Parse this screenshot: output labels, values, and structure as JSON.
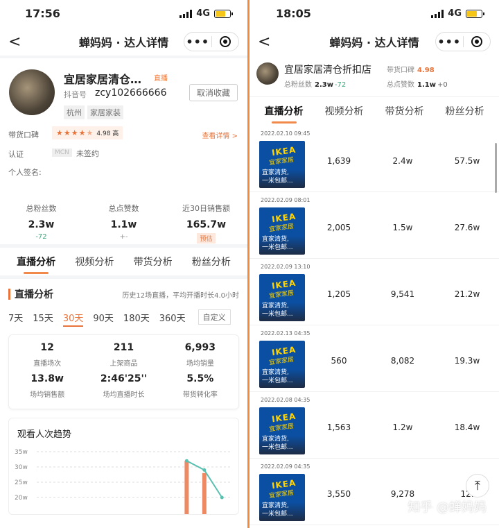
{
  "left": {
    "status": {
      "time": "17:56",
      "network": "4G"
    },
    "nav": {
      "title": "蝉妈妈 · 达人详情",
      "back": "<",
      "menu": "•••"
    },
    "profile": {
      "name": "宜居家居清仓…",
      "crown": "直播",
      "douyin_label": "抖音号",
      "douyin_id": "zcy102666666",
      "unfavorite": "取消收藏",
      "tags": [
        "杭州",
        "家居家装"
      ],
      "reputation_label": "带货口碑",
      "reputation_score": "4.98 高",
      "stars": 4.5,
      "detail_link": "查看详情 >",
      "cert_label": "认证",
      "mcn": "MCN",
      "cert_value": "未签约",
      "signature_label": "个人签名:"
    },
    "stats": [
      {
        "label": "总粉丝数",
        "value": "2.3w",
        "sub": "-72"
      },
      {
        "label": "总点赞数",
        "value": "1.1w",
        "sub": "+-"
      },
      {
        "label": "近30日销售额",
        "value": "165.7w",
        "sub": "预估"
      }
    ],
    "tabs": [
      "直播分析",
      "视频分析",
      "带货分析",
      "粉丝分析"
    ],
    "live": {
      "title": "直播分析",
      "info": "历史12场直播，平均开播时长4.0小时",
      "days": [
        "7天",
        "15天",
        "30天",
        "90天",
        "180天",
        "360天"
      ],
      "custom": "自定义",
      "metrics": [
        {
          "value": "12",
          "label": "直播场次"
        },
        {
          "value": "211",
          "label": "上架商品"
        },
        {
          "value": "6,993",
          "label": "场均销量"
        },
        {
          "value": "13.8w",
          "label": "场均销售额"
        },
        {
          "value": "2:46'25''",
          "label": "场均直播时长"
        },
        {
          "value": "5.5%",
          "label": "带货转化率"
        }
      ],
      "trend_title": "观看人次趋势"
    },
    "chart_data": {
      "type": "line",
      "title": "观看人次趋势",
      "ytick_labels": [
        "35w",
        "30w",
        "25w",
        "20w"
      ],
      "ylim": [
        20,
        35
      ],
      "series": [
        {
          "values": [
            null,
            null,
            null,
            null,
            null,
            null,
            null,
            null,
            32,
            29,
            20
          ]
        }
      ],
      "bars": [
        0,
        0,
        0,
        0,
        0,
        0,
        0,
        0,
        32,
        28,
        0
      ]
    }
  },
  "right": {
    "status": {
      "time": "18:05",
      "network": "4G"
    },
    "nav": {
      "title": "蝉妈妈 · 达人详情",
      "back": "<",
      "menu": "•••"
    },
    "profile": {
      "name": "宜居家居清仓折扣店",
      "fans_label": "总粉丝数",
      "fans": "2.3w",
      "fans_delta": "-72",
      "rep_label": "带货口碑",
      "rep": "4.98",
      "likes_label": "总点赞数",
      "likes": "1.1w",
      "likes_delta": "+0"
    },
    "tabs": [
      "直播分析",
      "视频分析",
      "带货分析",
      "粉丝分析"
    ],
    "items": [
      {
        "date": "2022.02.10 09:45",
        "viewers": "1,639",
        "sales": "2.4w",
        "amount": "57.5w"
      },
      {
        "date": "2022.02.09 08:01",
        "viewers": "2,005",
        "sales": "1.5w",
        "amount": "27.6w"
      },
      {
        "date": "2022.02.09 13:10",
        "viewers": "1,205",
        "sales": "9,541",
        "amount": "21.2w"
      },
      {
        "date": "2022.02.13 04:35",
        "viewers": "560",
        "sales": "8,082",
        "amount": "19.3w"
      },
      {
        "date": "2022.02.08 04:35",
        "viewers": "1,563",
        "sales": "1.2w",
        "amount": "18.4w"
      },
      {
        "date": "2022.02.09 04:35",
        "viewers": "3,550",
        "sales": "9,278",
        "amount": "12."
      }
    ],
    "thumb": {
      "brand": "IKEA",
      "brand_cn": "宜家家居",
      "caption1": "宜家清货,",
      "caption2": "一米包邮..."
    },
    "watermark": "知乎 @蝉妈妈",
    "top_button": "⤒"
  }
}
